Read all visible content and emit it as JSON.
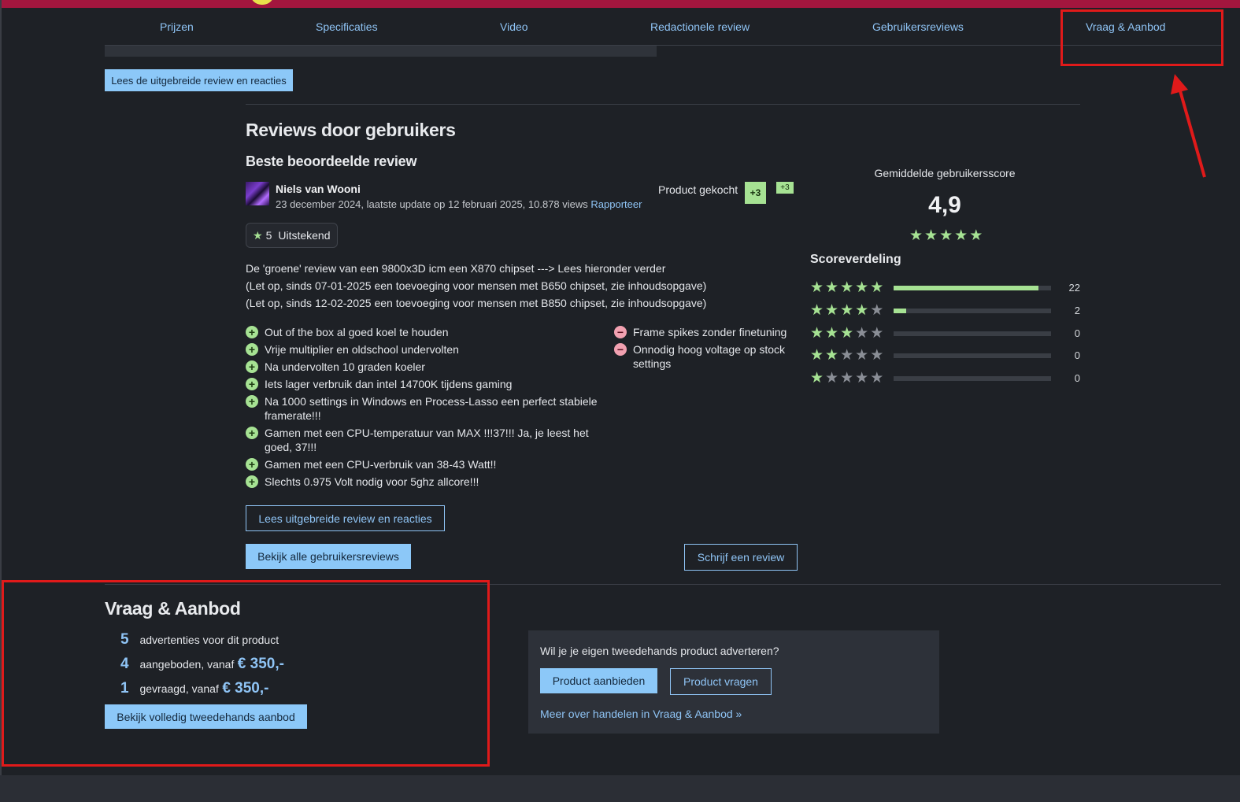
{
  "nav": {
    "tabs": [
      "Prijzen",
      "Specificaties",
      "Video",
      "Redactionele review",
      "Gebruikersreviews",
      "Vraag & Aanbod"
    ]
  },
  "top_button": "Lees de uitgebreide review en reacties",
  "reviews": {
    "heading": "Reviews door gebruikers",
    "subheading": "Beste beoordeelde review",
    "author": "Niels van Wooni",
    "meta": "23 december 2024, laatste update op 12 februari 2025, 10.878 views",
    "report_link": "Rapporteer",
    "product_bought": "Product gekocht",
    "score_badge": "+3",
    "score_badge_small": "+3",
    "rating_value": "5",
    "rating_label": "Uitstekend",
    "description": [
      "De 'groene' review van een 9800x3D icm een X870 chipset ---> Lees hieronder verder",
      "(Let op, sinds 07-01-2025 een toevoeging voor mensen met B650 chipset, zie inhoudsopgave)",
      "(Let op, sinds 12-02-2025 een toevoeging voor mensen met B850 chipset, zie inhoudsopgave)"
    ],
    "pros": [
      "Out of the box al goed koel te houden",
      "Vrije multiplier en oldschool undervolten",
      "Na undervolten 10 graden koeler",
      "Iets lager verbruik dan intel 14700K tijdens gaming",
      "Na 1000 settings in Windows en Process-Lasso een perfect stabiele framerate!!!",
      "Gamen met een CPU-temperatuur van MAX !!!37!!! Ja, je leest het goed, 37!!!",
      "Gamen met een CPU-verbruik van 38-43 Watt!!",
      "Slechts 0.975 Volt nodig voor 5ghz allcore!!!"
    ],
    "cons": [
      "Frame spikes zonder finetuning",
      "Onnodig hoog voltage op stock settings"
    ],
    "read_full_button": "Lees uitgebreide review en reacties",
    "all_reviews_button": "Bekijk alle gebruikersreviews",
    "write_review_button": "Schrijf een review"
  },
  "score": {
    "label": "Gemiddelde gebruikersscore",
    "value": "4,9",
    "stars_filled": 5,
    "distribution_title": "Scoreverdeling",
    "distribution": [
      {
        "stars": 5,
        "count": "22",
        "fraction": 0.92
      },
      {
        "stars": 4,
        "count": "2",
        "fraction": 0.08
      },
      {
        "stars": 3,
        "count": "0",
        "fraction": 0
      },
      {
        "stars": 2,
        "count": "0",
        "fraction": 0
      },
      {
        "stars": 1,
        "count": "0",
        "fraction": 0
      }
    ]
  },
  "vraag_aanbod": {
    "heading": "Vraag & Aanbod",
    "ads_count": "5",
    "ads_text": "advertenties voor dit product",
    "offered_count": "4",
    "offered_text": "aangeboden, vanaf",
    "offered_price": "€ 350,-",
    "wanted_count": "1",
    "wanted_text": "gevraagd, vanaf",
    "wanted_price": "€ 350,-",
    "view_all_button": "Bekijk volledig tweedehands aanbod",
    "panel_question": "Wil je je eigen tweedehands product adverteren?",
    "offer_button": "Product aanbieden",
    "ask_button": "Product vragen",
    "more_link": "Meer over handelen in Vraag & Aanbod »"
  },
  "colors": {
    "accent_link": "#8fc4f5",
    "positive": "#a6e293",
    "negative": "#f2a1b1",
    "annotation": "#e01a1a",
    "topbar": "#a3163e"
  }
}
